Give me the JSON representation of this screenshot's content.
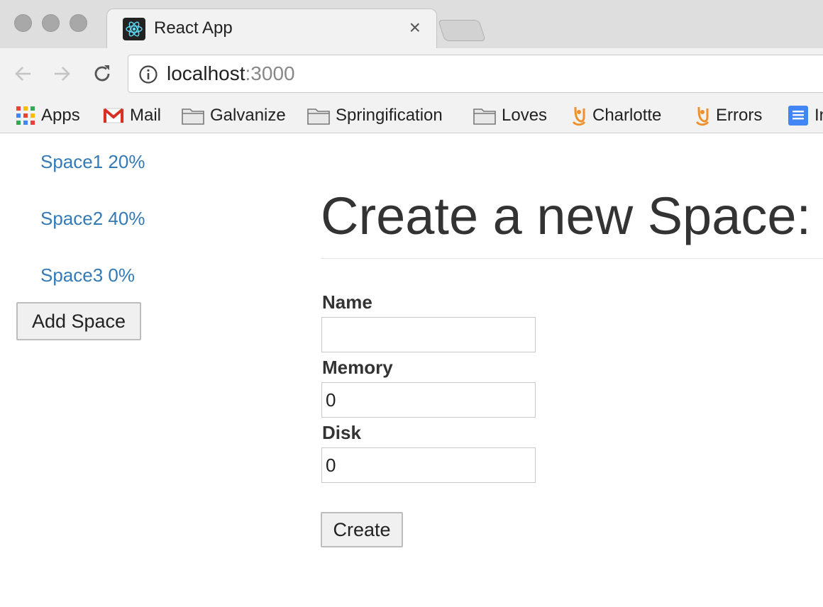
{
  "browser": {
    "tab_title": "React App",
    "tab_close": "×",
    "url_host": "localhost",
    "url_port": ":3000",
    "bookmarks": [
      {
        "label": "Apps",
        "icon": "apps-grid-icon"
      },
      {
        "label": "Mail",
        "icon": "gmail-icon"
      },
      {
        "label": "Galvanize",
        "icon": "folder-icon"
      },
      {
        "label": "Springification",
        "icon": "folder-icon"
      },
      {
        "label": "Loves",
        "icon": "folder-icon"
      },
      {
        "label": "Charlotte",
        "icon": "custom-site-icon"
      },
      {
        "label": "Errors",
        "icon": "custom-site-icon"
      },
      {
        "label": "In",
        "icon": "docs-icon"
      }
    ]
  },
  "sidebar": {
    "spaces": [
      {
        "label": "Space1 20%"
      },
      {
        "label": "Space2 40%"
      },
      {
        "label": "Space3 0%"
      }
    ],
    "add_button": "Add Space"
  },
  "form": {
    "heading": "Create a new Space:",
    "name_label": "Name",
    "name_value": "",
    "memory_label": "Memory",
    "memory_value": "0",
    "disk_label": "Disk",
    "disk_value": "0",
    "create_button": "Create"
  },
  "colors": {
    "link": "#337ab7",
    "text": "#333333",
    "chrome": "#f2f2f2"
  }
}
